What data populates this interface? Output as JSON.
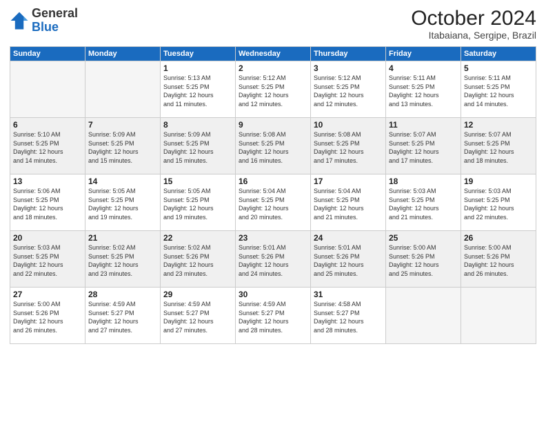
{
  "header": {
    "logo_general": "General",
    "logo_blue": "Blue",
    "month_title": "October 2024",
    "location": "Itabaiana, Sergipe, Brazil"
  },
  "weekdays": [
    "Sunday",
    "Monday",
    "Tuesday",
    "Wednesday",
    "Thursday",
    "Friday",
    "Saturday"
  ],
  "weeks": [
    [
      {
        "day": "",
        "info": ""
      },
      {
        "day": "",
        "info": ""
      },
      {
        "day": "1",
        "info": "Sunrise: 5:13 AM\nSunset: 5:25 PM\nDaylight: 12 hours\nand 11 minutes."
      },
      {
        "day": "2",
        "info": "Sunrise: 5:12 AM\nSunset: 5:25 PM\nDaylight: 12 hours\nand 12 minutes."
      },
      {
        "day": "3",
        "info": "Sunrise: 5:12 AM\nSunset: 5:25 PM\nDaylight: 12 hours\nand 12 minutes."
      },
      {
        "day": "4",
        "info": "Sunrise: 5:11 AM\nSunset: 5:25 PM\nDaylight: 12 hours\nand 13 minutes."
      },
      {
        "day": "5",
        "info": "Sunrise: 5:11 AM\nSunset: 5:25 PM\nDaylight: 12 hours\nand 14 minutes."
      }
    ],
    [
      {
        "day": "6",
        "info": "Sunrise: 5:10 AM\nSunset: 5:25 PM\nDaylight: 12 hours\nand 14 minutes."
      },
      {
        "day": "7",
        "info": "Sunrise: 5:09 AM\nSunset: 5:25 PM\nDaylight: 12 hours\nand 15 minutes."
      },
      {
        "day": "8",
        "info": "Sunrise: 5:09 AM\nSunset: 5:25 PM\nDaylight: 12 hours\nand 15 minutes."
      },
      {
        "day": "9",
        "info": "Sunrise: 5:08 AM\nSunset: 5:25 PM\nDaylight: 12 hours\nand 16 minutes."
      },
      {
        "day": "10",
        "info": "Sunrise: 5:08 AM\nSunset: 5:25 PM\nDaylight: 12 hours\nand 17 minutes."
      },
      {
        "day": "11",
        "info": "Sunrise: 5:07 AM\nSunset: 5:25 PM\nDaylight: 12 hours\nand 17 minutes."
      },
      {
        "day": "12",
        "info": "Sunrise: 5:07 AM\nSunset: 5:25 PM\nDaylight: 12 hours\nand 18 minutes."
      }
    ],
    [
      {
        "day": "13",
        "info": "Sunrise: 5:06 AM\nSunset: 5:25 PM\nDaylight: 12 hours\nand 18 minutes."
      },
      {
        "day": "14",
        "info": "Sunrise: 5:05 AM\nSunset: 5:25 PM\nDaylight: 12 hours\nand 19 minutes."
      },
      {
        "day": "15",
        "info": "Sunrise: 5:05 AM\nSunset: 5:25 PM\nDaylight: 12 hours\nand 19 minutes."
      },
      {
        "day": "16",
        "info": "Sunrise: 5:04 AM\nSunset: 5:25 PM\nDaylight: 12 hours\nand 20 minutes."
      },
      {
        "day": "17",
        "info": "Sunrise: 5:04 AM\nSunset: 5:25 PM\nDaylight: 12 hours\nand 21 minutes."
      },
      {
        "day": "18",
        "info": "Sunrise: 5:03 AM\nSunset: 5:25 PM\nDaylight: 12 hours\nand 21 minutes."
      },
      {
        "day": "19",
        "info": "Sunrise: 5:03 AM\nSunset: 5:25 PM\nDaylight: 12 hours\nand 22 minutes."
      }
    ],
    [
      {
        "day": "20",
        "info": "Sunrise: 5:03 AM\nSunset: 5:25 PM\nDaylight: 12 hours\nand 22 minutes."
      },
      {
        "day": "21",
        "info": "Sunrise: 5:02 AM\nSunset: 5:25 PM\nDaylight: 12 hours\nand 23 minutes."
      },
      {
        "day": "22",
        "info": "Sunrise: 5:02 AM\nSunset: 5:26 PM\nDaylight: 12 hours\nand 23 minutes."
      },
      {
        "day": "23",
        "info": "Sunrise: 5:01 AM\nSunset: 5:26 PM\nDaylight: 12 hours\nand 24 minutes."
      },
      {
        "day": "24",
        "info": "Sunrise: 5:01 AM\nSunset: 5:26 PM\nDaylight: 12 hours\nand 25 minutes."
      },
      {
        "day": "25",
        "info": "Sunrise: 5:00 AM\nSunset: 5:26 PM\nDaylight: 12 hours\nand 25 minutes."
      },
      {
        "day": "26",
        "info": "Sunrise: 5:00 AM\nSunset: 5:26 PM\nDaylight: 12 hours\nand 26 minutes."
      }
    ],
    [
      {
        "day": "27",
        "info": "Sunrise: 5:00 AM\nSunset: 5:26 PM\nDaylight: 12 hours\nand 26 minutes."
      },
      {
        "day": "28",
        "info": "Sunrise: 4:59 AM\nSunset: 5:27 PM\nDaylight: 12 hours\nand 27 minutes."
      },
      {
        "day": "29",
        "info": "Sunrise: 4:59 AM\nSunset: 5:27 PM\nDaylight: 12 hours\nand 27 minutes."
      },
      {
        "day": "30",
        "info": "Sunrise: 4:59 AM\nSunset: 5:27 PM\nDaylight: 12 hours\nand 28 minutes."
      },
      {
        "day": "31",
        "info": "Sunrise: 4:58 AM\nSunset: 5:27 PM\nDaylight: 12 hours\nand 28 minutes."
      },
      {
        "day": "",
        "info": ""
      },
      {
        "day": "",
        "info": ""
      }
    ]
  ]
}
